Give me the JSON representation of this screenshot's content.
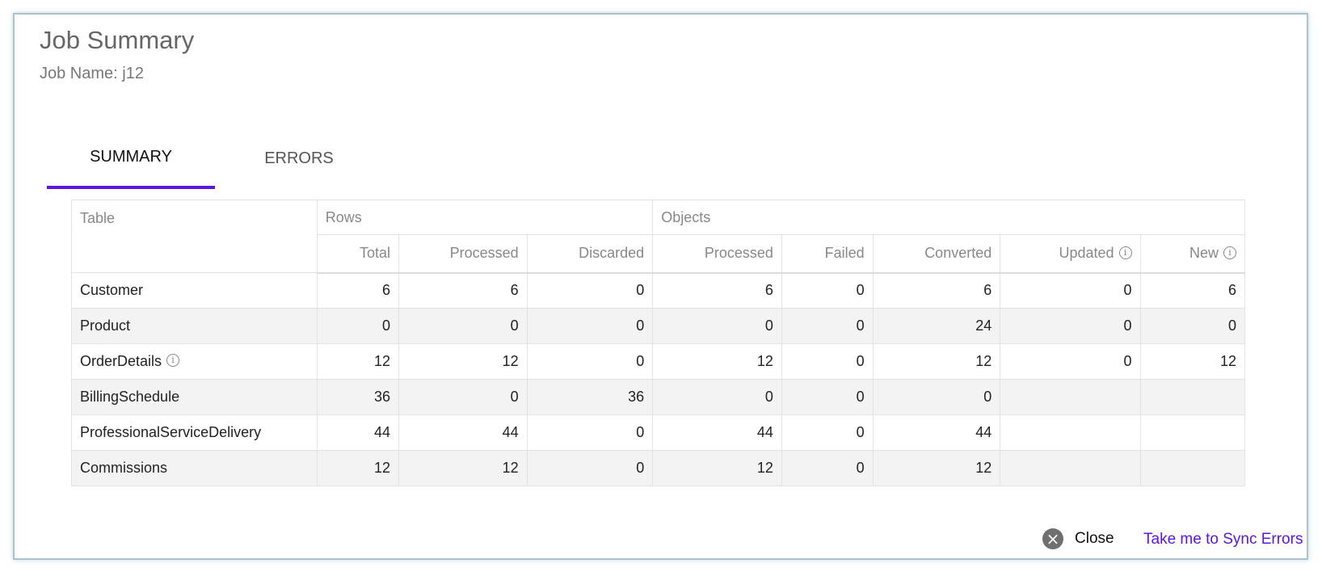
{
  "dialog": {
    "title": "Job Summary",
    "job_name": "Job Name: j12"
  },
  "tabs": [
    {
      "label": "SUMMARY",
      "active": true
    },
    {
      "label": "ERRORS",
      "active": false
    }
  ],
  "table": {
    "group_headers": {
      "table": "Table",
      "rows": "Rows",
      "objects": "Objects"
    },
    "sub_headers": [
      "Total",
      "Processed",
      "Discarded",
      "Processed",
      "Failed",
      "Converted",
      "Updated",
      "New"
    ],
    "rows": [
      {
        "name": "Customer",
        "info": false,
        "values": [
          "6",
          "6",
          "0",
          "6",
          "0",
          "6",
          "0",
          "6"
        ]
      },
      {
        "name": "Product",
        "info": false,
        "values": [
          "0",
          "0",
          "0",
          "0",
          "0",
          "24",
          "0",
          "0"
        ]
      },
      {
        "name": "OrderDetails",
        "info": true,
        "values": [
          "12",
          "12",
          "0",
          "12",
          "0",
          "12",
          "0",
          "12"
        ]
      },
      {
        "name": "BillingSchedule",
        "info": false,
        "values": [
          "36",
          "0",
          "36",
          "0",
          "0",
          "0",
          "",
          ""
        ]
      },
      {
        "name": "ProfessionalServiceDelivery",
        "info": false,
        "values": [
          "44",
          "44",
          "0",
          "44",
          "0",
          "44",
          "",
          ""
        ]
      },
      {
        "name": "Commissions",
        "info": false,
        "values": [
          "12",
          "12",
          "0",
          "12",
          "0",
          "12",
          "",
          ""
        ]
      }
    ]
  },
  "footer": {
    "close_label": "Close",
    "sync_link": "Take me to Sync Errors"
  },
  "colors": {
    "accent": "#5b16e0",
    "close_icon_bg": "#6f6f6f",
    "row_stripe": "#f3f3f3"
  },
  "icons": {
    "info": "info-icon",
    "close": "close-circle-icon"
  }
}
